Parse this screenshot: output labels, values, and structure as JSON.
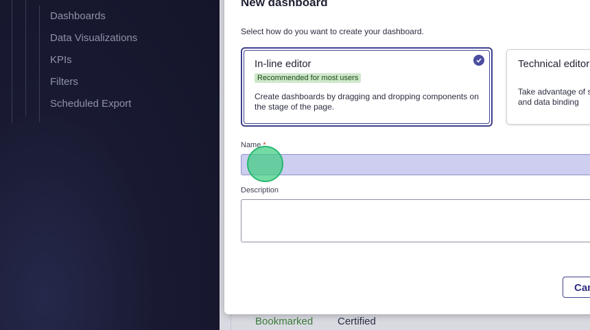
{
  "sidebar": {
    "items": [
      {
        "label": "Dashboards"
      },
      {
        "label": "Data Visualizations"
      },
      {
        "label": "KPIs"
      },
      {
        "label": "Filters"
      },
      {
        "label": "Scheduled Export"
      }
    ]
  },
  "background_row": {
    "bookmarked": "Bookmarked",
    "certified": "Certified"
  },
  "modal": {
    "title": "New dashboard",
    "subtitle": "Select how do you want to create your dashboard.",
    "options": [
      {
        "title": "In-line editor",
        "badge": "Recommended for most users",
        "description": "Create dashboards by dragging and dropping components on the stage of the page.",
        "selected": true
      },
      {
        "title": "Technical editor",
        "description": "Take advantage of scripting and data binding",
        "selected": false
      }
    ],
    "name_label": "Name",
    "required_marker": "*",
    "name_value": "",
    "description_label": "Description",
    "description_value": "",
    "cancel_label": "Cancel"
  },
  "colors": {
    "accent": "#3d3f8f",
    "badge_bg": "#cde8c9",
    "input_focus_bg": "#cdcef0",
    "sidebar_bg": "#191a32"
  }
}
